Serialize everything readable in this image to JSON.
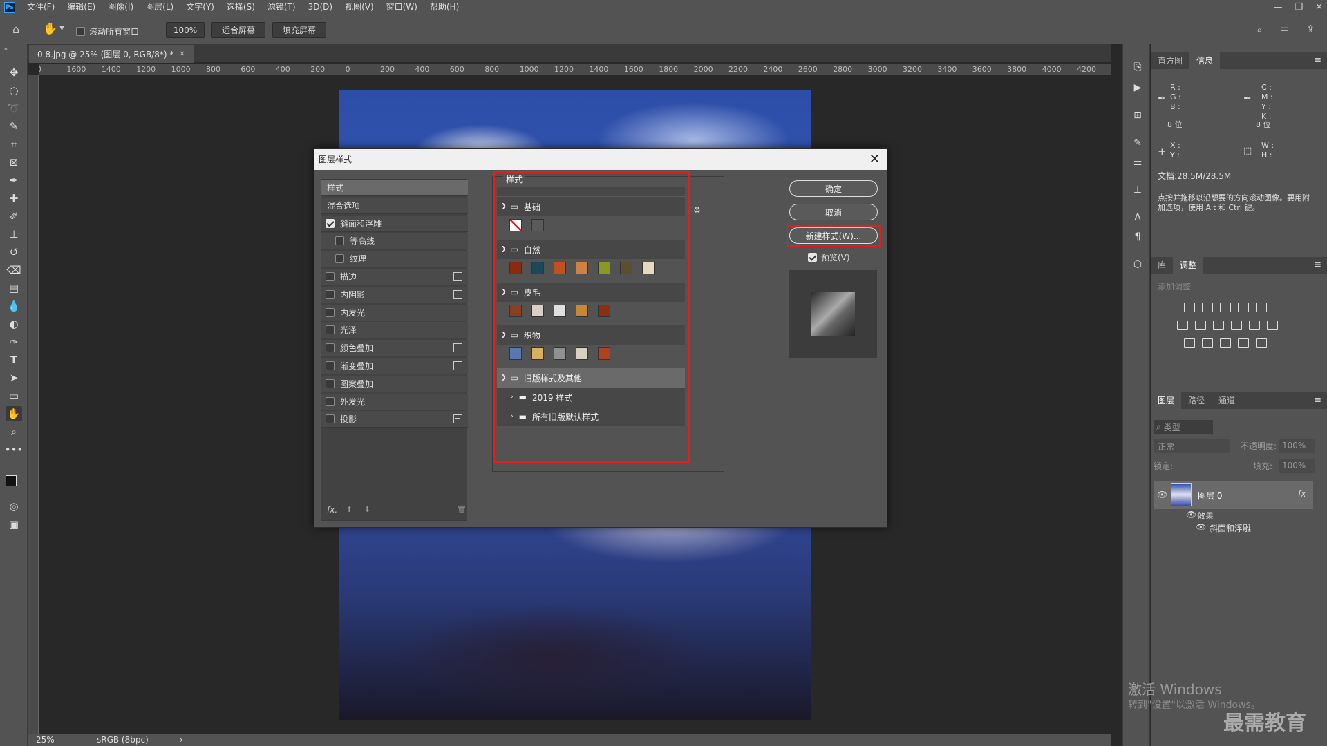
{
  "menu": [
    "文件(F)",
    "编辑(E)",
    "图像(I)",
    "图层(L)",
    "文字(Y)",
    "选择(S)",
    "滤镜(T)",
    "3D(D)",
    "视图(V)",
    "窗口(W)",
    "帮助(H)"
  ],
  "options": {
    "scroll_all": "滚动所有窗口",
    "zoom": "100%",
    "fit_screen": "适合屏幕",
    "fill_screen": "填充屏幕"
  },
  "doc_tab": "0.8.jpg @ 25% (图层 0, RGB/8*) *",
  "ruler_ticks": [
    "00",
    "1600",
    "1400",
    "1200",
    "1000",
    "800",
    "600",
    "400",
    "200",
    "0",
    "200",
    "400",
    "600",
    "800",
    "1000",
    "1200",
    "1400",
    "1600",
    "1800",
    "2000",
    "2200",
    "2400",
    "2600",
    "2800",
    "3000",
    "3200",
    "3400",
    "3600",
    "3800",
    "4000",
    "4200",
    "44"
  ],
  "status": {
    "zoom": "25%",
    "profile": "sRGB (8bpc)"
  },
  "dialog": {
    "title": "图层样式",
    "left_items": [
      {
        "label": "样式",
        "checkbox": false,
        "checked": false,
        "plus": false,
        "indent": false,
        "selected": true
      },
      {
        "label": "混合选项",
        "checkbox": false,
        "checked": false,
        "plus": false,
        "indent": false,
        "selected": false
      },
      {
        "label": "斜面和浮雕",
        "checkbox": true,
        "checked": true,
        "plus": false,
        "indent": false,
        "selected": false
      },
      {
        "label": "等高线",
        "checkbox": true,
        "checked": false,
        "plus": false,
        "indent": true,
        "selected": false
      },
      {
        "label": "纹理",
        "checkbox": true,
        "checked": false,
        "plus": false,
        "indent": true,
        "selected": false
      },
      {
        "label": "描边",
        "checkbox": true,
        "checked": false,
        "plus": true,
        "indent": false,
        "selected": false
      },
      {
        "label": "内阴影",
        "checkbox": true,
        "checked": false,
        "plus": true,
        "indent": false,
        "selected": false
      },
      {
        "label": "内发光",
        "checkbox": true,
        "checked": false,
        "plus": false,
        "indent": false,
        "selected": false
      },
      {
        "label": "光泽",
        "checkbox": true,
        "checked": false,
        "plus": false,
        "indent": false,
        "selected": false
      },
      {
        "label": "颜色叠加",
        "checkbox": true,
        "checked": false,
        "plus": true,
        "indent": false,
        "selected": false
      },
      {
        "label": "渐变叠加",
        "checkbox": true,
        "checked": false,
        "plus": true,
        "indent": false,
        "selected": false
      },
      {
        "label": "图案叠加",
        "checkbox": true,
        "checked": false,
        "plus": false,
        "indent": false,
        "selected": false
      },
      {
        "label": "外发光",
        "checkbox": true,
        "checked": false,
        "plus": false,
        "indent": false,
        "selected": false
      },
      {
        "label": "投影",
        "checkbox": true,
        "checked": false,
        "plus": true,
        "indent": false,
        "selected": false
      }
    ],
    "fx_label": "fx.",
    "styles_header": "样式",
    "groups": [
      {
        "name": "基础",
        "swatches": [
          "#ffffff",
          "#5a5a5a"
        ]
      },
      {
        "name": "自然",
        "swatches": [
          "#8a2a10",
          "#1a4a5a",
          "#c05020",
          "#d08040",
          "#8a9a20",
          "#5a5030",
          "#e8d8c0",
          "#7a6040",
          "#c8c8c8"
        ]
      },
      {
        "name": "皮毛",
        "swatches": [
          "#8a4020",
          "#d8d0c8",
          "#e0e0e0",
          "#c88830",
          "#8a3010"
        ]
      },
      {
        "name": "织物",
        "swatches": [
          "#5a78b0",
          "#d8b060",
          "#909090",
          "#d8d0c0",
          "#b04020"
        ]
      }
    ],
    "legacy_group": "旧版样式及其他",
    "legacy_sub": [
      "2019 样式",
      "所有旧版默认样式"
    ],
    "ok": "确定",
    "cancel": "取消",
    "new_style": "新建样式(W)...",
    "preview": "预览(V)"
  },
  "panels": {
    "top_tabs": [
      "直方图",
      "信息"
    ],
    "info": {
      "r": "R :",
      "g": "G :",
      "b": "B :",
      "bits": "8 位",
      "c": "C :",
      "m": "M :",
      "y": "Y :",
      "k": "K :",
      "bits2": "8 位",
      "x": "X :",
      "y2": "Y :",
      "w": "W :",
      "h": "H :",
      "doc": "文档:28.5M/28.5M",
      "hint": "点按并拖移以沿想要的方向滚动图像。要用附加选项，使用 Alt 和 Ctrl 键。"
    },
    "mid_tabs": [
      "库",
      "调整"
    ],
    "adj_label": "添加调整",
    "layer_tabs": [
      "图层",
      "路径",
      "通道"
    ],
    "layer_search": "类型",
    "blend": "正常",
    "opacity_label": "不透明度:",
    "opacity": "100%",
    "lock_label": "锁定:",
    "fill_label": "填充:",
    "fill": "100%",
    "layer_name": "图层 0",
    "effects": "效果",
    "effect_item": "斜面和浮雕"
  },
  "watermark": {
    "line1": "激活 Windows",
    "line2": "转到\"设置\"以激活 Windows。",
    "brand": "最需教育"
  }
}
